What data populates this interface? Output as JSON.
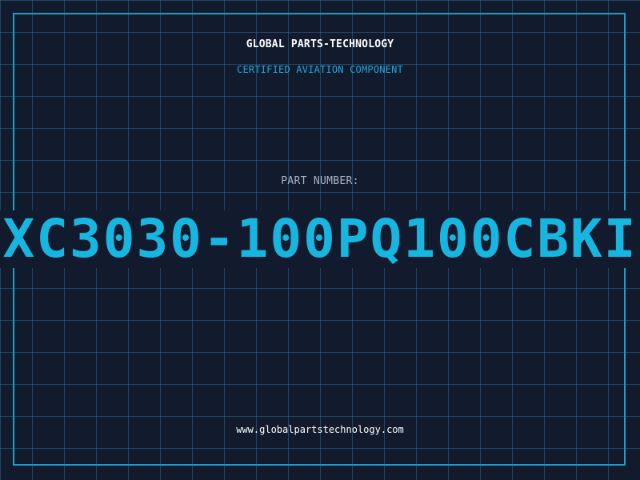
{
  "brand": "GLOBAL PARTS-TECHNOLOGY",
  "subtitle": "CERTIFIED AVIATION COMPONENT",
  "part_number_label": "PART NUMBER:",
  "part_number": "XC3030-100PQ100CBKI",
  "website": "www.globalpartstechnology.com",
  "colors": {
    "background": "#121a2e",
    "grid": "#286e8c",
    "accent": "#17b6e0",
    "frame": "#1aa0cc",
    "text": "#ffffff"
  }
}
